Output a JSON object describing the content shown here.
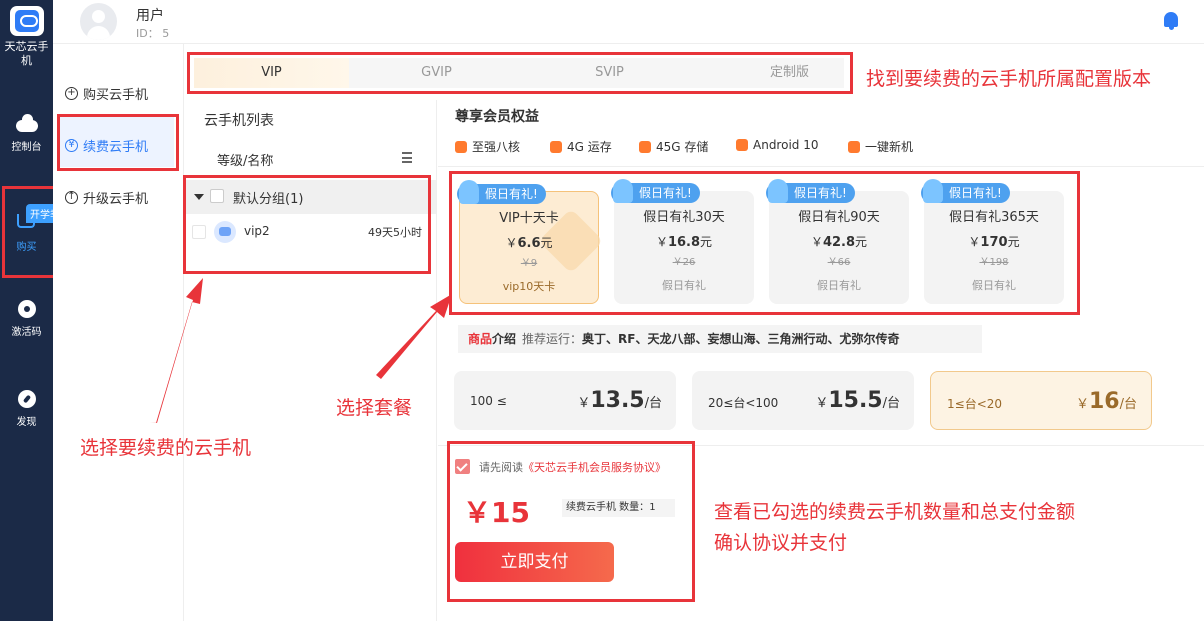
{
  "rail": {
    "brand": "天芯云手机",
    "console": "控制台",
    "buy": "购买",
    "buy_badge": "开学季",
    "activation": "激活码",
    "discover": "发现"
  },
  "user": {
    "name": "用户",
    "id": "ID： 5"
  },
  "side_menu": {
    "buy": "购买云手机",
    "renew": "续费云手机",
    "upgrade": "升级云手机"
  },
  "device_list": {
    "title": "云手机列表",
    "header": "等级/名称",
    "group": "默认分组(1)",
    "devices": [
      {
        "name": "vip2",
        "remaining": "49天5小时"
      }
    ]
  },
  "tabs": [
    "VIP",
    "GVIP",
    "SVIP",
    "定制版"
  ],
  "benefits": {
    "title": "尊享会员权益",
    "items": [
      "至强八核",
      "4G 运存",
      "45G 存储",
      "Android 10",
      "一键新机"
    ]
  },
  "plans": [
    {
      "ribbon": "假日有礼!",
      "name": "VIP十天卡",
      "price_prefix": "￥",
      "price": "6.6",
      "price_unit": "元",
      "original": "￥9",
      "note": "vip10天卡"
    },
    {
      "ribbon": "假日有礼!",
      "name": "假日有礼30天",
      "price_prefix": "￥",
      "price": "16.8",
      "price_unit": "元",
      "original": "￥26",
      "note": "假日有礼"
    },
    {
      "ribbon": "假日有礼!",
      "name": "假日有礼90天",
      "price_prefix": "￥",
      "price": "42.8",
      "price_unit": "元",
      "original": "￥66",
      "note": "假日有礼"
    },
    {
      "ribbon": "假日有礼!",
      "name": "假日有礼365天",
      "price_prefix": "￥",
      "price": "170",
      "price_unit": "元",
      "original": "￥198",
      "note": "假日有礼"
    }
  ],
  "intro": {
    "label_red": "商品",
    "label_bold": "介绍",
    "recommend_label": "推荐运行：",
    "recommend": "奥丁、RF、天龙八部、妄想山海、三角洲行动、尤弥尔传奇"
  },
  "tiers": [
    {
      "range": "100 ≤",
      "currency": "￥",
      "price": "13.5",
      "unit": "/台"
    },
    {
      "range": "20≤台<100",
      "currency": "￥",
      "price": "15.5",
      "unit": "/台"
    },
    {
      "range": "1≤台<20",
      "currency": "￥",
      "price": "16",
      "unit": "/台"
    }
  ],
  "payment": {
    "agree_prefix": "请先阅读",
    "agree_link": "《天芯云手机会员服务协议》",
    "total": "￥15",
    "qty_label": "续费云手机 数量：",
    "qty": "1",
    "pay_button": "立即支付"
  },
  "annotations": {
    "tabs": "找到要续费的云手机所属配置版本",
    "plans": "选择套餐",
    "list": "选择要续费的云手机",
    "pay_line1": "查看已勾选的续费云手机数量和总支付金额",
    "pay_line2": "确认协议并支付"
  },
  "colors": {
    "rail_bg": "#1b2a47",
    "accent_blue": "#2f7cf6",
    "annotation_red": "#e8343a",
    "gold": "#9a6a2a"
  }
}
